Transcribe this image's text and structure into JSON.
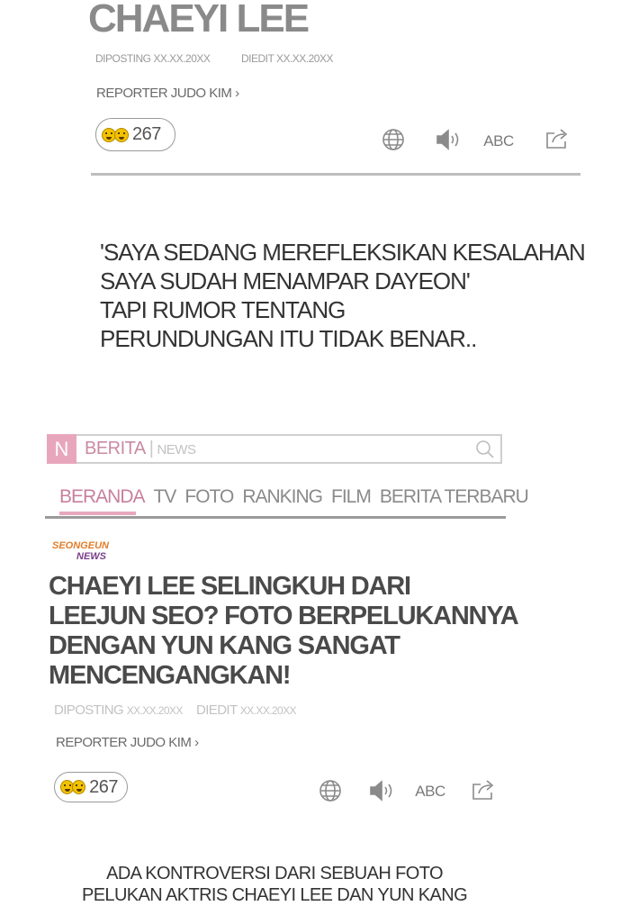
{
  "top_article": {
    "title": "CHAEYI LEE",
    "posted": "DIPOSTING XX.XX.20XX",
    "edited": "DIEDIT XX.XX.20XX",
    "reporter": "REPORTER JUDO KIM ›",
    "reaction_count": "267",
    "abc_label": "ABC",
    "quote_lines": [
      "'SAYA SEDANG MEREFLEKSIKAN KESALAHAN",
      "SAYA SUDAH MENAMPAR DAYEON'",
      "TAPI RUMOR TENTANG",
      "PERUNDUNGAN ITU TIDAK BENAR.."
    ]
  },
  "news_site": {
    "logo_letter": "N",
    "brand": "BERITA",
    "brand_sub": "NEWS",
    "nav": [
      "BERANDA",
      "TV",
      "FOTO",
      "RANKING",
      "FILM",
      "BERITA TERBARU"
    ],
    "active_nav_index": 0,
    "outlet_line1": "SEONGEUN",
    "outlet_line2": "NEWS",
    "headline_lines": [
      "CHAEYI LEE SELINGKUH DARI",
      "LEEJUN SEO?  FOTO BERPELUKANNYA",
      "DENGAN YUN KANG SANGAT",
      "MENCENGANGKAN!"
    ],
    "posted_label": "DIPOSTING",
    "posted_date": "XX.XX.20XX",
    "edited_label": "DIEDIT",
    "edited_date": "XX.XX.20XX",
    "reporter": "REPORTER JUDO KIM ›",
    "reaction_count": "267",
    "abc_label": "ABC",
    "intro_lines": [
      "ADA KONTROVERSI DARI SEBUAH FOTO",
      "PELUKAN AKTRIS CHAEYI LEE DAN YUN KANG"
    ]
  },
  "icons": [
    "emoji-icon",
    "globe-icon",
    "speaker-icon",
    "share-icon",
    "search-icon"
  ],
  "colors": {
    "brand_pink": "#e8a6bd",
    "nav_active": "#c8809c",
    "outlet_orange": "#e07d2a",
    "outlet_purple": "#7a3e8a",
    "emoji_yellow": "#f2c200"
  }
}
